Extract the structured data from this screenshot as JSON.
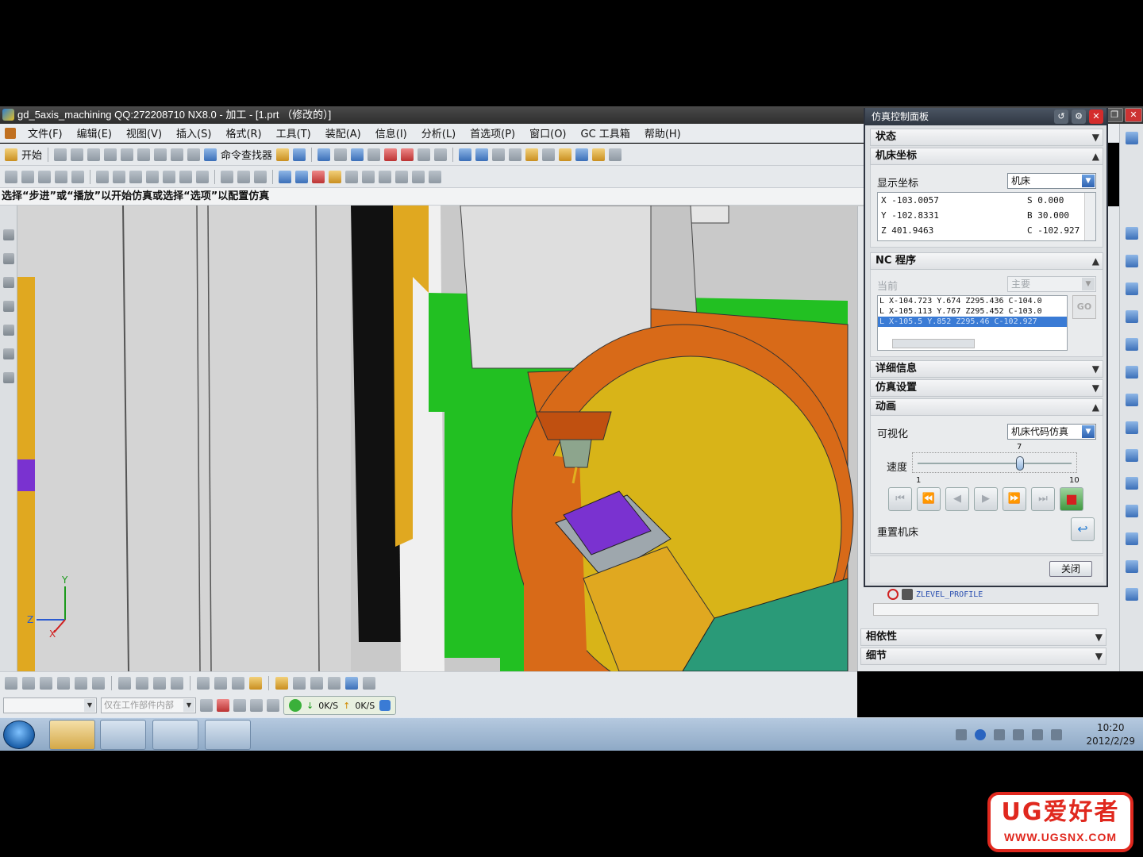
{
  "window": {
    "title": "gd_5axis_machining QQ:272208710 NX8.0 - 加工 - [1.prt （修改的）]"
  },
  "menubar": {
    "items": [
      "文件(F)",
      "编辑(E)",
      "视图(V)",
      "插入(S)",
      "格式(R)",
      "工具(T)",
      "装配(A)",
      "信息(I)",
      "分析(L)",
      "首选项(P)",
      "窗口(O)",
      "GC 工具箱",
      "帮助(H)"
    ]
  },
  "toolbar": {
    "start_label": "开始",
    "command_finder_label": "命令查找器"
  },
  "cue_line": "选择“步进”或“播放”以开始仿真或选择“选项”以配置仿真",
  "bottom_toolbar": {
    "selection_filter_placeholder": "仅在工作部件内部",
    "speed_down": "0K/S",
    "speed_up": "0K/S"
  },
  "sim_panel": {
    "title": "仿真控制面板",
    "status_section": "状态",
    "machine_coords_section": "机床坐标",
    "display_coords_label": "显示坐标",
    "display_coords_value": "机床",
    "coords": [
      {
        "left": "X -103.0057",
        "right": "S 0.000"
      },
      {
        "left": "Y -102.8331",
        "right": "B 30.000"
      },
      {
        "left": "Z 401.9463",
        "right": "C -102.927"
      }
    ],
    "nc_program_section": "NC 程序",
    "current_label": "当前",
    "main_value": "主要",
    "program_lines": [
      "L X-104.723 Y.674 Z295.436 C-104.0",
      "L X-105.113 Y.767 Z295.452 C-103.0",
      "L X-105.5 Y.852 Z295.46 C-102.927"
    ],
    "goto_label": "GO",
    "details_section": "详细信息",
    "sim_settings_section": "仿真设置",
    "animation_section": "动画",
    "visualization_label": "可视化",
    "visualization_value": "机床代码仿真",
    "speed_label": "速度",
    "speed_value": 7,
    "speed_min": "1",
    "speed_max": "10",
    "speed_current": "7",
    "reset_machine_label": "重置机床",
    "close_label": "关闭"
  },
  "navigator": {
    "operation": "ZLEVEL_PROFILE",
    "dependencies_section": "相依性",
    "details_section": "细节"
  },
  "taskbar": {
    "time": "10:20",
    "date": "2012/2/29"
  },
  "watermark": {
    "line1": "UG爱好者",
    "line2": "WWW.UGSNX.COM"
  },
  "colors": {
    "machine_green": "#22c022",
    "machine_orange": "#d86a18",
    "table_yellow": "#d8b418",
    "part_purple": "#7a32d0",
    "highlight_blue": "#3a7bd5"
  }
}
